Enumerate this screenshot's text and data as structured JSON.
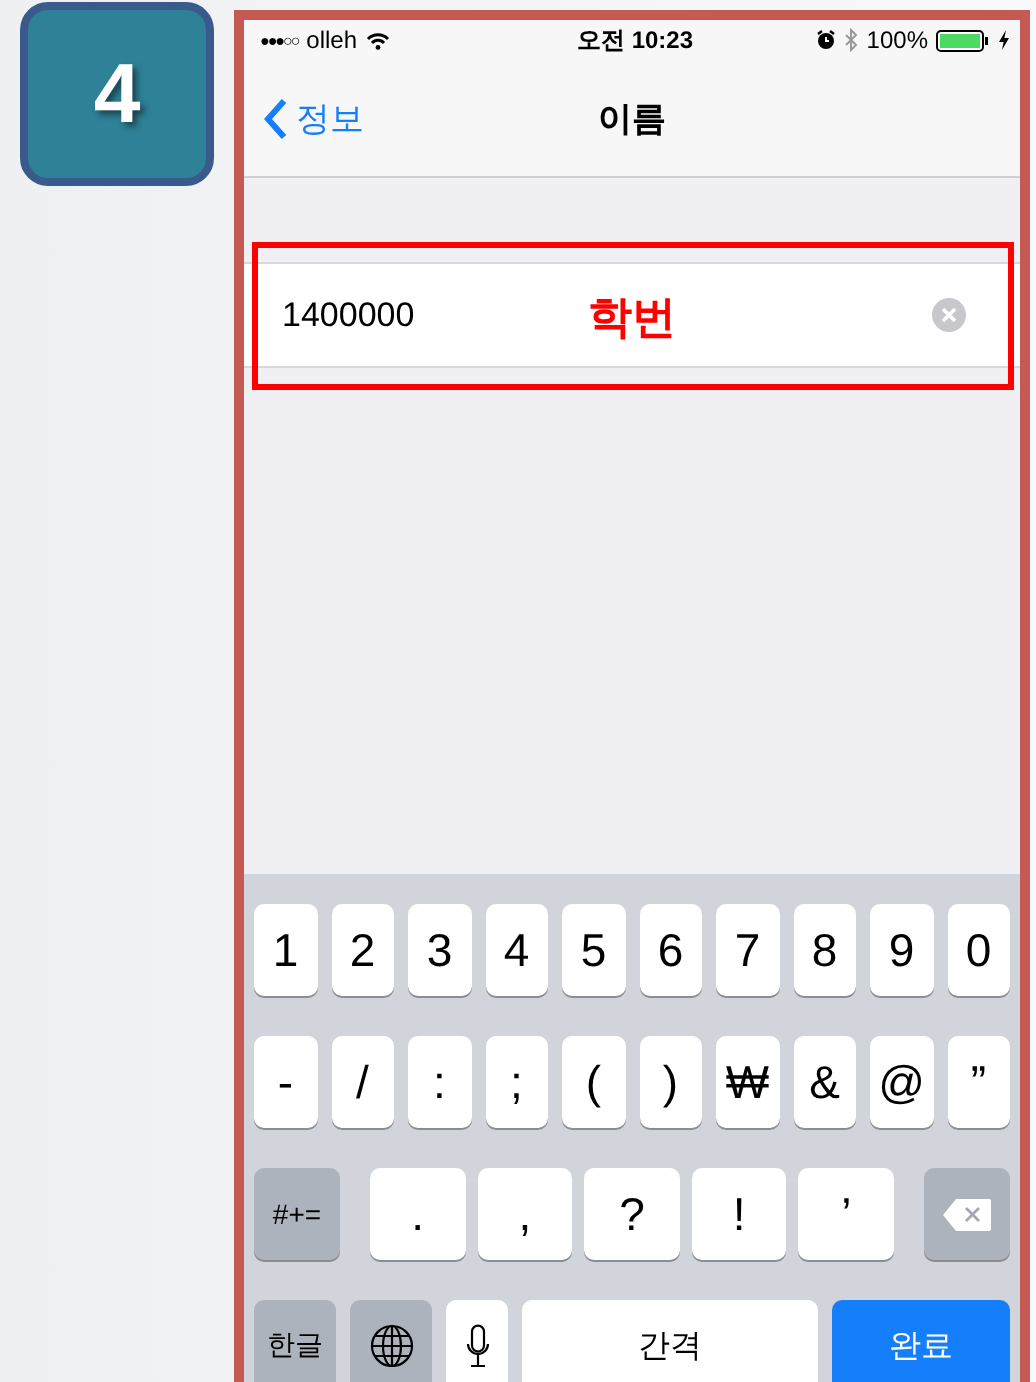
{
  "step_badge": {
    "number": "4"
  },
  "status_bar": {
    "signal": "●●●○○",
    "carrier": "olleh",
    "time": "오전 10:23",
    "battery": "100%"
  },
  "nav_bar": {
    "back": "정보",
    "title": "이름"
  },
  "text_field": {
    "value": "1400000"
  },
  "annotation": {
    "label": "학번"
  },
  "keyboard": {
    "rows": [
      {
        "keys": [
          {
            "kind": "char",
            "label": "1"
          },
          {
            "kind": "char",
            "label": "2"
          },
          {
            "kind": "char",
            "label": "3"
          },
          {
            "kind": "char",
            "label": "4"
          },
          {
            "kind": "char",
            "label": "5"
          },
          {
            "kind": "char",
            "label": "6"
          },
          {
            "kind": "char",
            "label": "7"
          },
          {
            "kind": "char",
            "label": "8"
          },
          {
            "kind": "char",
            "label": "9"
          },
          {
            "kind": "char",
            "label": "0"
          }
        ]
      },
      {
        "keys": [
          {
            "kind": "char",
            "label": "-"
          },
          {
            "kind": "char",
            "label": "/"
          },
          {
            "kind": "char",
            "label": ":"
          },
          {
            "kind": "char",
            "label": ";"
          },
          {
            "kind": "char",
            "label": "("
          },
          {
            "kind": "char",
            "label": ")"
          },
          {
            "kind": "char",
            "label": "₩"
          },
          {
            "kind": "char",
            "label": "&"
          },
          {
            "kind": "char",
            "label": "@"
          },
          {
            "kind": "char",
            "label": "”"
          }
        ]
      },
      {
        "keys": [
          {
            "kind": "mod",
            "label": "#+="
          },
          {
            "kind": "wide",
            "label": "."
          },
          {
            "kind": "wide",
            "label": ","
          },
          {
            "kind": "wide",
            "label": "?"
          },
          {
            "kind": "wide",
            "label": "!"
          },
          {
            "kind": "wide",
            "label": "’"
          },
          {
            "kind": "backspace"
          }
        ]
      },
      {
        "keys": [
          {
            "kind": "mod",
            "label": "한글"
          },
          {
            "kind": "globe"
          },
          {
            "kind": "mic"
          },
          {
            "kind": "space",
            "label": "간격"
          },
          {
            "kind": "done",
            "label": "완료"
          }
        ]
      }
    ]
  }
}
